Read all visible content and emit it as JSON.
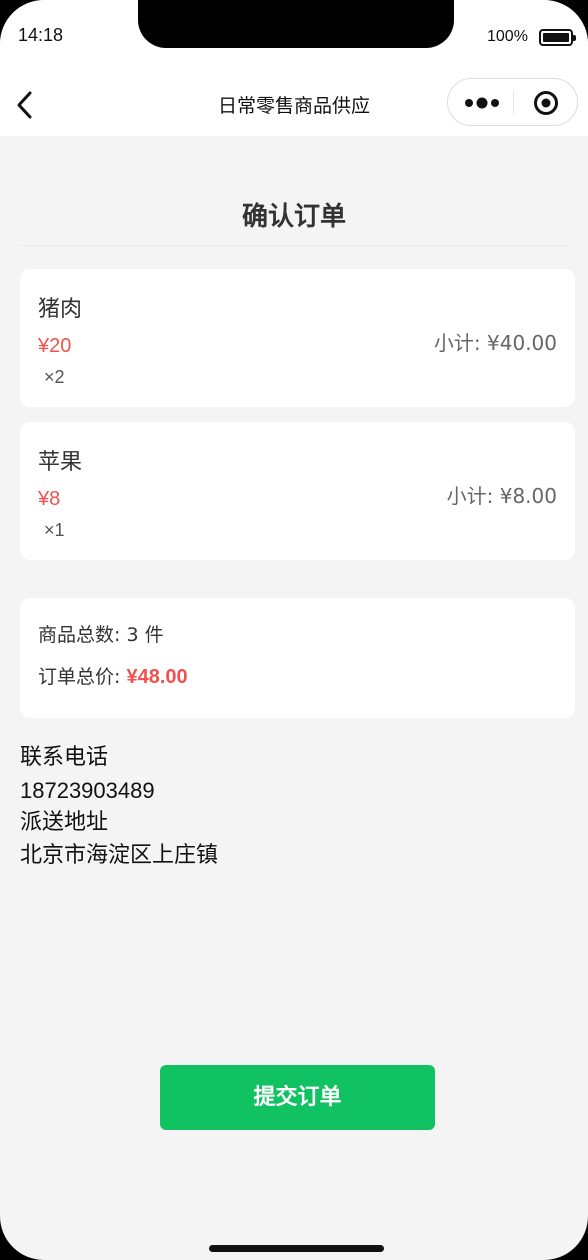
{
  "status_bar": {
    "time": "14:18",
    "battery": "100%"
  },
  "nav": {
    "title": "日常零售商品供应"
  },
  "page": {
    "title": "确认订单"
  },
  "items": [
    {
      "name": "猪肉",
      "price": "¥20",
      "qty": "×2",
      "subtotal": "小计: ¥40.00"
    },
    {
      "name": "苹果",
      "price": "¥8",
      "qty": "×1",
      "subtotal": "小计: ¥8.00"
    }
  ],
  "summary": {
    "count_text": "商品总数: 3 件",
    "total_label": "订单总价: ",
    "total_value": "¥48.00"
  },
  "contact": {
    "phone_label": "联系电话",
    "phone": "18723903489",
    "address_label": "派送地址",
    "address": "北京市海淀区上庄镇"
  },
  "actions": {
    "submit_label": "提交订单"
  },
  "colors": {
    "accent_green": "#11c262",
    "price_red": "#f0524f",
    "background": "#f4f4f4"
  }
}
